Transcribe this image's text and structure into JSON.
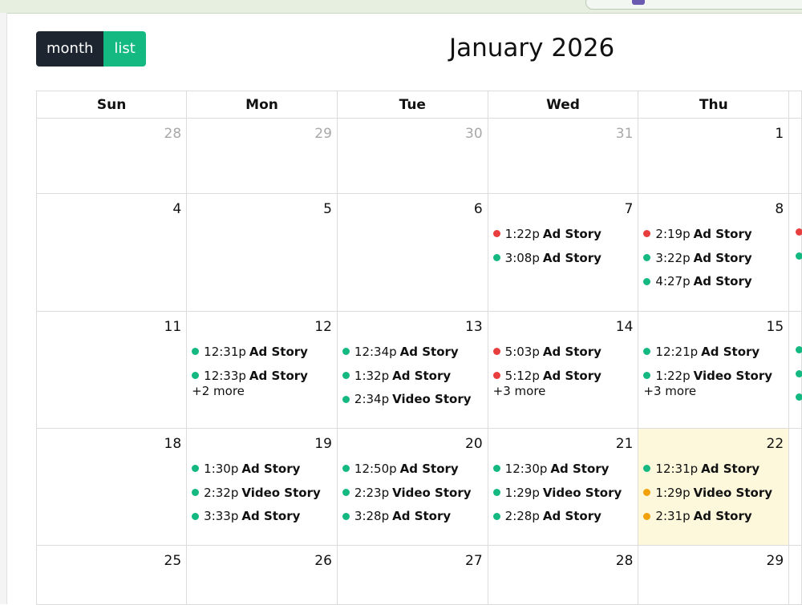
{
  "toolbar": {
    "view_month_label": "month",
    "view_list_label": "list",
    "title": "January 2026"
  },
  "colors": {
    "green": "#14b881",
    "red": "#e83e3e",
    "orange": "#f1a10a",
    "dark": "#1c2530",
    "today_bg": "#fdf8dc"
  },
  "calendar": {
    "weekdays": [
      "Sun",
      "Mon",
      "Tue",
      "Wed",
      "Thu"
    ],
    "weeks": [
      {
        "days": [
          {
            "num": "28",
            "other": true,
            "events": []
          },
          {
            "num": "29",
            "other": true,
            "events": []
          },
          {
            "num": "30",
            "other": true,
            "events": []
          },
          {
            "num": "31",
            "other": true,
            "events": []
          },
          {
            "num": "1",
            "events": []
          }
        ]
      },
      {
        "days": [
          {
            "num": "4",
            "events": []
          },
          {
            "num": "5",
            "events": []
          },
          {
            "num": "6",
            "events": []
          },
          {
            "num": "7",
            "events": [
              {
                "time": "1:22p",
                "title": "Ad Story",
                "color": "red"
              },
              {
                "time": "3:08p",
                "title": "Ad Story",
                "color": "green"
              }
            ]
          },
          {
            "num": "8",
            "events": [
              {
                "time": "2:19p",
                "title": "Ad Story",
                "color": "red"
              },
              {
                "time": "3:22p",
                "title": "Ad Story",
                "color": "green"
              },
              {
                "time": "4:27p",
                "title": "Ad Story",
                "color": "green"
              }
            ]
          }
        ]
      },
      {
        "days": [
          {
            "num": "11",
            "events": []
          },
          {
            "num": "12",
            "events": [
              {
                "time": "12:31p",
                "title": "Ad Story",
                "color": "green"
              },
              {
                "time": "12:33p",
                "title": "Ad Story",
                "color": "green"
              }
            ],
            "more": "+2 more"
          },
          {
            "num": "13",
            "events": [
              {
                "time": "12:34p",
                "title": "Ad Story",
                "color": "green"
              },
              {
                "time": "1:32p",
                "title": "Ad Story",
                "color": "green"
              },
              {
                "time": "2:34p",
                "title": "Video Story",
                "color": "green"
              }
            ]
          },
          {
            "num": "14",
            "events": [
              {
                "time": "5:03p",
                "title": "Ad Story",
                "color": "red"
              },
              {
                "time": "5:12p",
                "title": "Ad Story",
                "color": "red"
              }
            ],
            "more": "+3 more"
          },
          {
            "num": "15",
            "events": [
              {
                "time": "12:21p",
                "title": "Ad Story",
                "color": "green"
              },
              {
                "time": "1:22p",
                "title": "Video Story",
                "color": "green"
              }
            ],
            "more": "+3 more"
          }
        ]
      },
      {
        "days": [
          {
            "num": "18",
            "events": []
          },
          {
            "num": "19",
            "events": [
              {
                "time": "1:30p",
                "title": "Ad Story",
                "color": "green"
              },
              {
                "time": "2:32p",
                "title": "Video Story",
                "color": "green"
              },
              {
                "time": "3:33p",
                "title": "Ad Story",
                "color": "green"
              }
            ]
          },
          {
            "num": "20",
            "events": [
              {
                "time": "12:50p",
                "title": "Ad Story",
                "color": "green"
              },
              {
                "time": "2:23p",
                "title": "Video Story",
                "color": "green"
              },
              {
                "time": "3:28p",
                "title": "Ad Story",
                "color": "green"
              }
            ]
          },
          {
            "num": "21",
            "events": [
              {
                "time": "12:30p",
                "title": "Ad Story",
                "color": "green"
              },
              {
                "time": "1:29p",
                "title": "Video Story",
                "color": "green"
              },
              {
                "time": "2:28p",
                "title": "Ad Story",
                "color": "green"
              }
            ]
          },
          {
            "num": "22",
            "today": true,
            "events": [
              {
                "time": "12:31p",
                "title": "Ad Story",
                "color": "green"
              },
              {
                "time": "1:29p",
                "title": "Video Story",
                "color": "orange"
              },
              {
                "time": "2:31p",
                "title": "Ad Story",
                "color": "orange"
              }
            ]
          }
        ]
      },
      {
        "days": [
          {
            "num": "25",
            "events": []
          },
          {
            "num": "26",
            "events": []
          },
          {
            "num": "27",
            "events": []
          },
          {
            "num": "28",
            "events": []
          },
          {
            "num": "29",
            "events": []
          }
        ]
      }
    ],
    "clipped_friday_dots": [
      {
        "week": 1,
        "colors": [
          "red",
          "green"
        ]
      },
      {
        "week": 2,
        "colors": [
          "green",
          "green",
          "green"
        ]
      }
    ]
  }
}
